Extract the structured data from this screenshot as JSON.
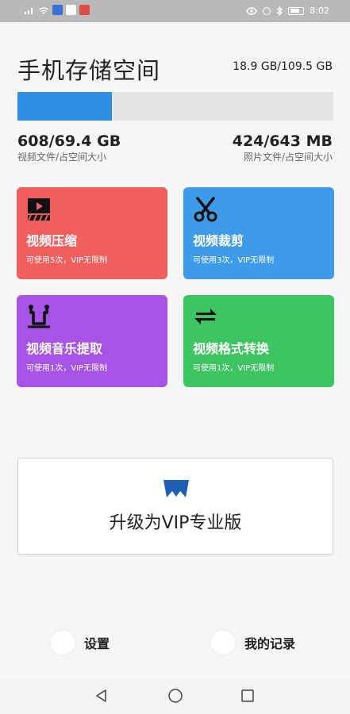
{
  "status_bar": {
    "time": "8:02",
    "left_icons": [
      "signal-icon",
      "wifi-icon",
      "app-notification-icon",
      "app-notification-icon",
      "app-notification-icon"
    ],
    "right_icons": [
      "eye-icon",
      "vibrate-icon",
      "bluetooth-icon",
      "battery-icon"
    ]
  },
  "storage": {
    "title": "手机存储空间",
    "total": "18.9 GB/109.5 GB",
    "usage_fraction": 0.3,
    "video": {
      "value": "608/69.4 GB",
      "label": "视频文件/占空间大小"
    },
    "photo": {
      "value": "424/643 MB",
      "label": "照片文件/占空间大小"
    }
  },
  "tools": [
    {
      "name": "视频压缩",
      "note": "可使用5次，VIP无限制",
      "icon": "clapperboard-icon",
      "color": "#f15e5e"
    },
    {
      "name": "视频裁剪",
      "note": "可使用3次，VIP无限制",
      "icon": "scissors-icon",
      "color": "#3d9bea"
    },
    {
      "name": "视频音乐提取",
      "note": "可使用1次，VIP无限制",
      "icon": "music-extract-icon",
      "color": "#a653e6"
    },
    {
      "name": "视频格式转换",
      "note": "可使用1次，VIP无限制",
      "icon": "convert-arrows-icon",
      "color": "#3fc462"
    }
  ],
  "vip": {
    "label": "升级为VIP专业版",
    "icon": "vip-crown-icon"
  },
  "bottom_nav": [
    {
      "label": "设置",
      "icon": "settings-icon"
    },
    {
      "label": "我的记录",
      "icon": "records-icon"
    }
  ],
  "system_nav": [
    "back-icon",
    "home-icon",
    "recent-apps-icon"
  ]
}
